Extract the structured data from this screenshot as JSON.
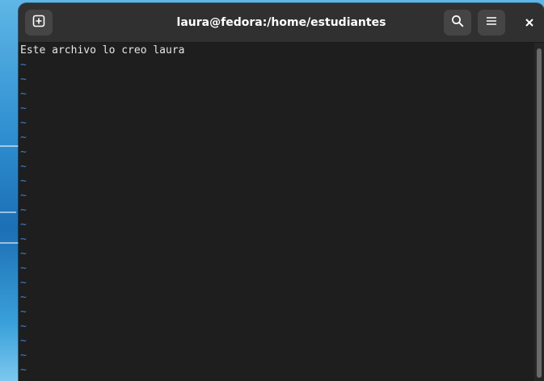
{
  "window": {
    "title": "laura@fedora:/home/estudiantes",
    "close_glyph": "×"
  },
  "icons": {
    "new_tab": "new-tab-icon",
    "search": "search-icon",
    "menu": "hamburger-menu-icon",
    "close": "close-icon"
  },
  "terminal": {
    "lines": [
      "Este archivo lo creo laura"
    ],
    "empty_line_marker": "~",
    "empty_line_count": 22,
    "tilde_color": "#3f7fd6"
  }
}
